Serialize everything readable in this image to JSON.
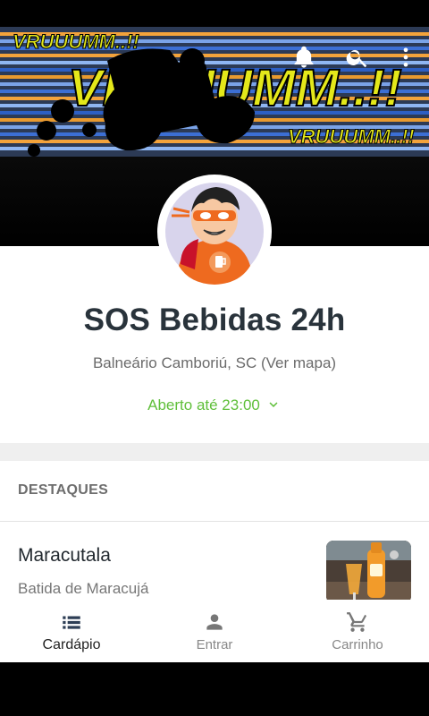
{
  "header": {
    "banner_text_small": "VRUUUMM..!!",
    "banner_text_big": "VRUUUMM..!!",
    "banner_text_right": "VRUUUMM..!!",
    "icons": [
      "bell-icon",
      "search-icon",
      "more-vert-icon"
    ]
  },
  "store": {
    "name": "SOS Bebidas 24h",
    "location": "Balneário Camboriú, SC (Ver mapa)",
    "hours": "Aberto até 23:00"
  },
  "highlights": {
    "title": "DESTAQUES",
    "items": [
      {
        "name": "Maracutala",
        "description": "Batida de Maracujá"
      }
    ]
  },
  "bottom_nav": [
    {
      "label": "Cardápio",
      "icon": "menu-list-icon",
      "active": true
    },
    {
      "label": "Entrar",
      "icon": "person-icon",
      "active": false
    },
    {
      "label": "Carrinho",
      "icon": "cart-icon",
      "active": false
    }
  ],
  "colors": {
    "accent_green": "#5fbf3a",
    "title": "#29333b",
    "banner_yellow": "#e4e81a"
  }
}
